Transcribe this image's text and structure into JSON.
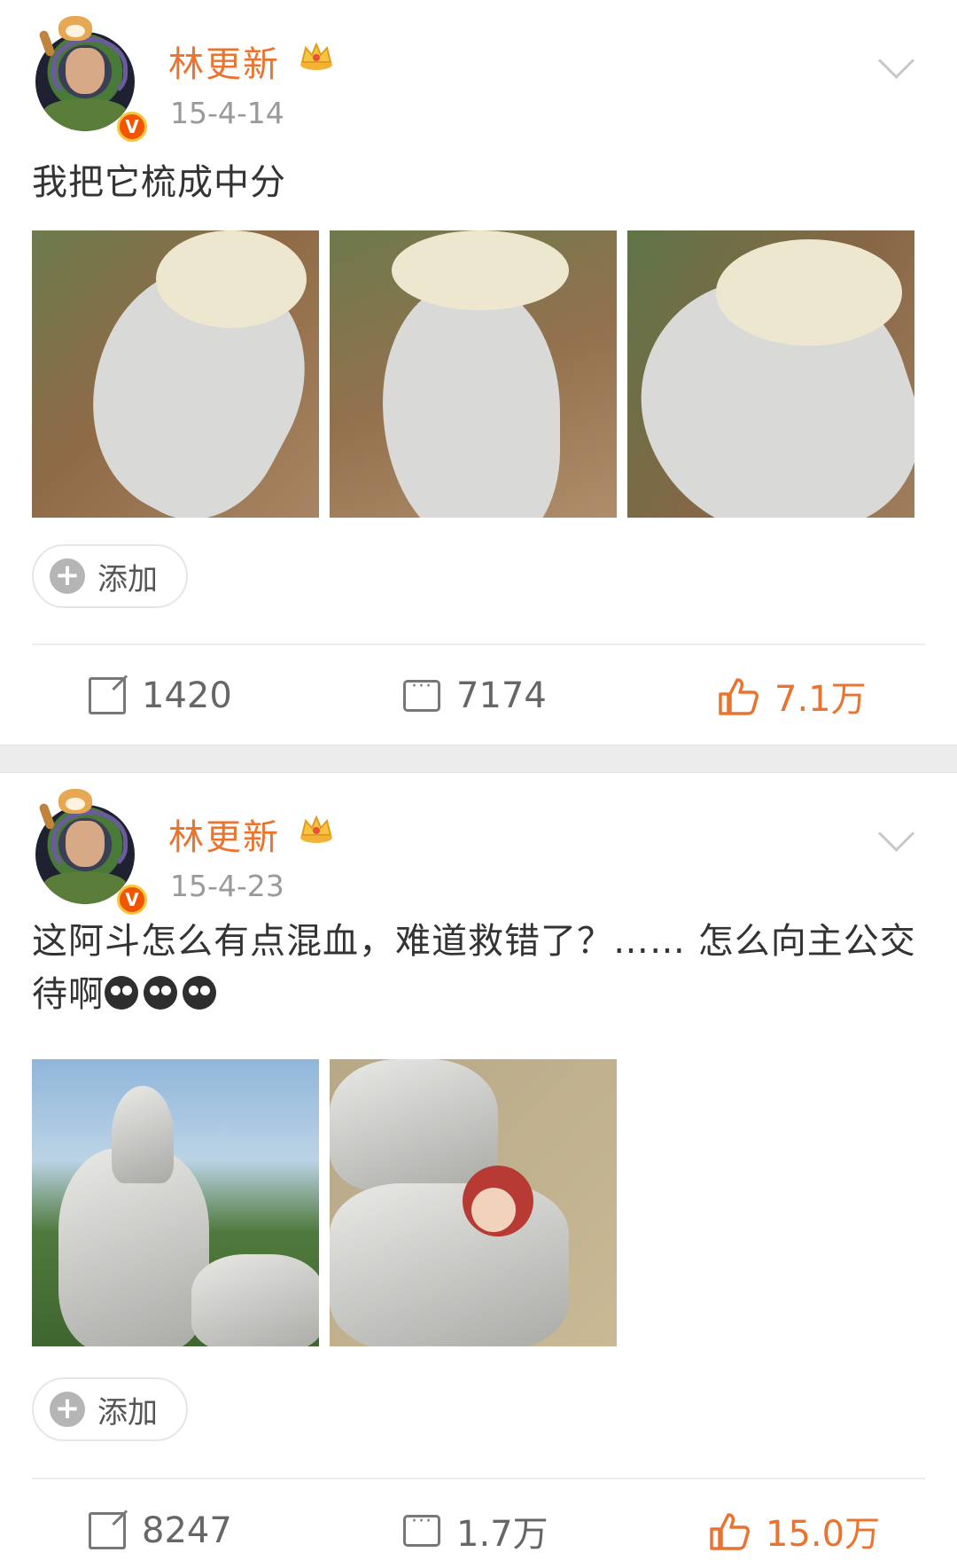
{
  "posts": [
    {
      "username": "林更新",
      "timestamp": "15-4-14",
      "text": "我把它梳成中分",
      "add_label": "添加",
      "reposts": "1420",
      "comments": "7174",
      "likes": "7.1万",
      "photos": [
        "horse-photo-1",
        "horse-photo-2",
        "horse-photo-3"
      ]
    },
    {
      "username": "林更新",
      "timestamp": "15-4-23",
      "text": "这阿斗怎么有点混血，难道救错了？…… 怎么向主公交待啊",
      "add_label": "添加",
      "reposts": "8247",
      "comments": "1.7万",
      "likes": "15.0万",
      "photos": [
        "armor-photo-1",
        "armor-photo-2"
      ]
    }
  ],
  "colors": {
    "accent": "#eb7330",
    "verified": "#f25500",
    "separator": "#ececec"
  },
  "icons": [
    "crown-icon",
    "chevron-down-icon",
    "add-icon",
    "repost-icon",
    "comment-icon",
    "like-icon",
    "verified-badge-icon",
    "crying-emoji-icon"
  ]
}
